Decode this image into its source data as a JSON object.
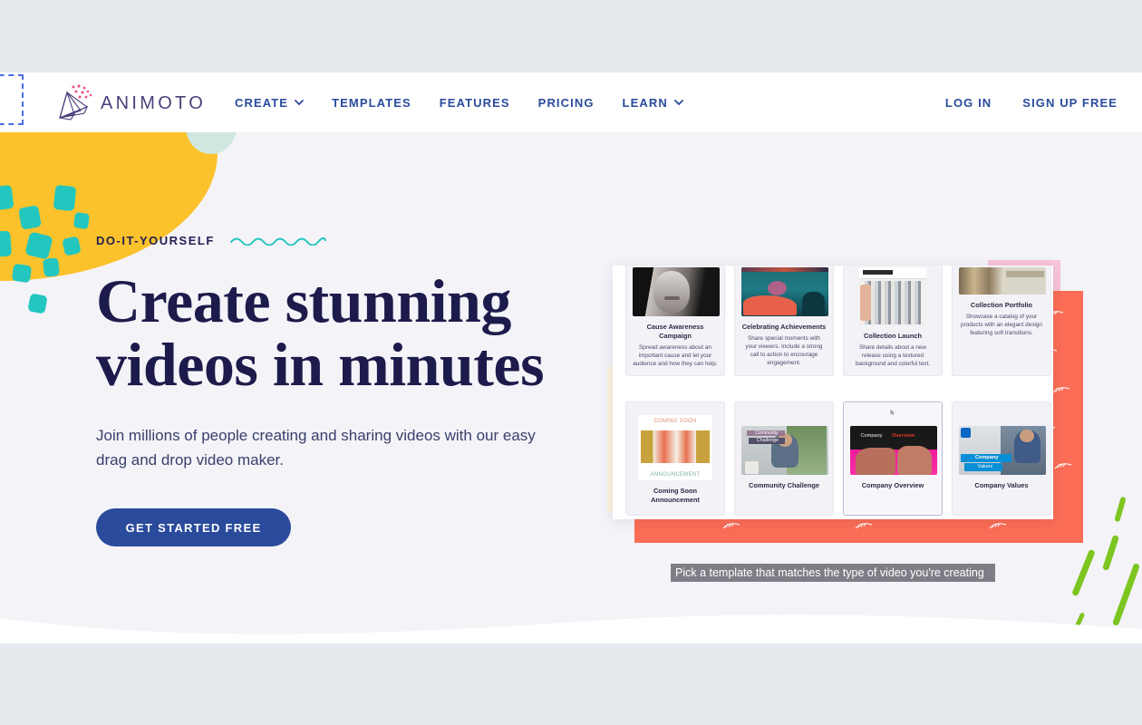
{
  "header": {
    "logo_text": "ANIMOTO",
    "logo_icon": "animoto-fan-logo",
    "nav": [
      {
        "label": "CREATE",
        "has_dropdown": true,
        "icon": "chevron-down-icon"
      },
      {
        "label": "TEMPLATES",
        "has_dropdown": false
      },
      {
        "label": "FEATURES",
        "has_dropdown": false
      },
      {
        "label": "PRICING",
        "has_dropdown": false
      },
      {
        "label": "LEARN",
        "has_dropdown": true,
        "icon": "chevron-down-icon"
      }
    ],
    "auth": [
      {
        "label": "LOG IN"
      },
      {
        "label": "SIGN UP FREE"
      }
    ],
    "nav_color": "#2a4a9c",
    "logo_color": "#4a3f7a"
  },
  "hero": {
    "eyebrow": "DO-IT-YOURSELF",
    "squiggle_color": "#23c7c0",
    "headline_line1": "Create stunning",
    "headline_line2": "videos in minutes",
    "headline_color": "#1d1b4b",
    "subhead": "Join millions of people creating and sharing videos with our easy drag and drop video maker.",
    "cta_label": "GET STARTED FREE",
    "cta_bg": "#2a4a9c",
    "cta_text_color": "#ffffff"
  },
  "decor": {
    "yellow": "#fcc22b",
    "teal": "#23c7c0",
    "green": "#7dc520",
    "coral": "#fb6d56",
    "pink": "#f9c5d8",
    "cream": "#fdf0dd",
    "mint": "#cfe7df",
    "page_bg": "#f4f3f8",
    "chrome_bg": "#e6e9ee"
  },
  "screenshot": {
    "tooltip": "Pick a template that matches the type of video you're creating",
    "rows": [
      {
        "cards": [
          {
            "title": "Cause Awareness Campaign",
            "desc": "Spread awareness about an important cause and let your audience and how they can help.",
            "thumb": "bw-portrait-thumbnail",
            "selected": false
          },
          {
            "title": "Celebrating Achievements",
            "desc": "Share special moments with your viewers. Include a strong call to action to encourage engagement.",
            "thumb": "teal-night-scene-thumbnail",
            "selected": false
          },
          {
            "title": "Collection Launch",
            "desc": "Share details about a new release using a textured background and colorful text.",
            "thumb": "clothing-rack-thumbnail",
            "selected": false
          },
          {
            "title": "Collection Portfolio",
            "desc": "Showcase a catalog of your products with an elegant design featuring soft transitions.",
            "thumb": "handbags-thumbnail",
            "selected": false
          }
        ]
      },
      {
        "cards": [
          {
            "title": "Coming Soon Announcement",
            "desc": "",
            "thumb": "coming-soon-announcement-thumbnail",
            "selected": false
          },
          {
            "title": "Community Challenge",
            "desc": "",
            "thumb": "community-challenge-thumbnail",
            "selected": false
          },
          {
            "title": "Company Overview",
            "desc": "",
            "thumb": "company-overview-thumbnail",
            "selected": true
          },
          {
            "title": "Company Values",
            "desc": "",
            "thumb": "company-values-thumbnail",
            "selected": false
          }
        ]
      }
    ],
    "thumb_labels": {
      "coming_soon_top": "COMING SOON",
      "coming_soon_bottom": "ANNOUNCEMENT",
      "community_tag1": "Community",
      "community_tag2": "Challenge",
      "company_overview_a": "Company",
      "company_overview_b": "Overview",
      "company_values_a": "Company",
      "company_values_b": "Values"
    }
  }
}
